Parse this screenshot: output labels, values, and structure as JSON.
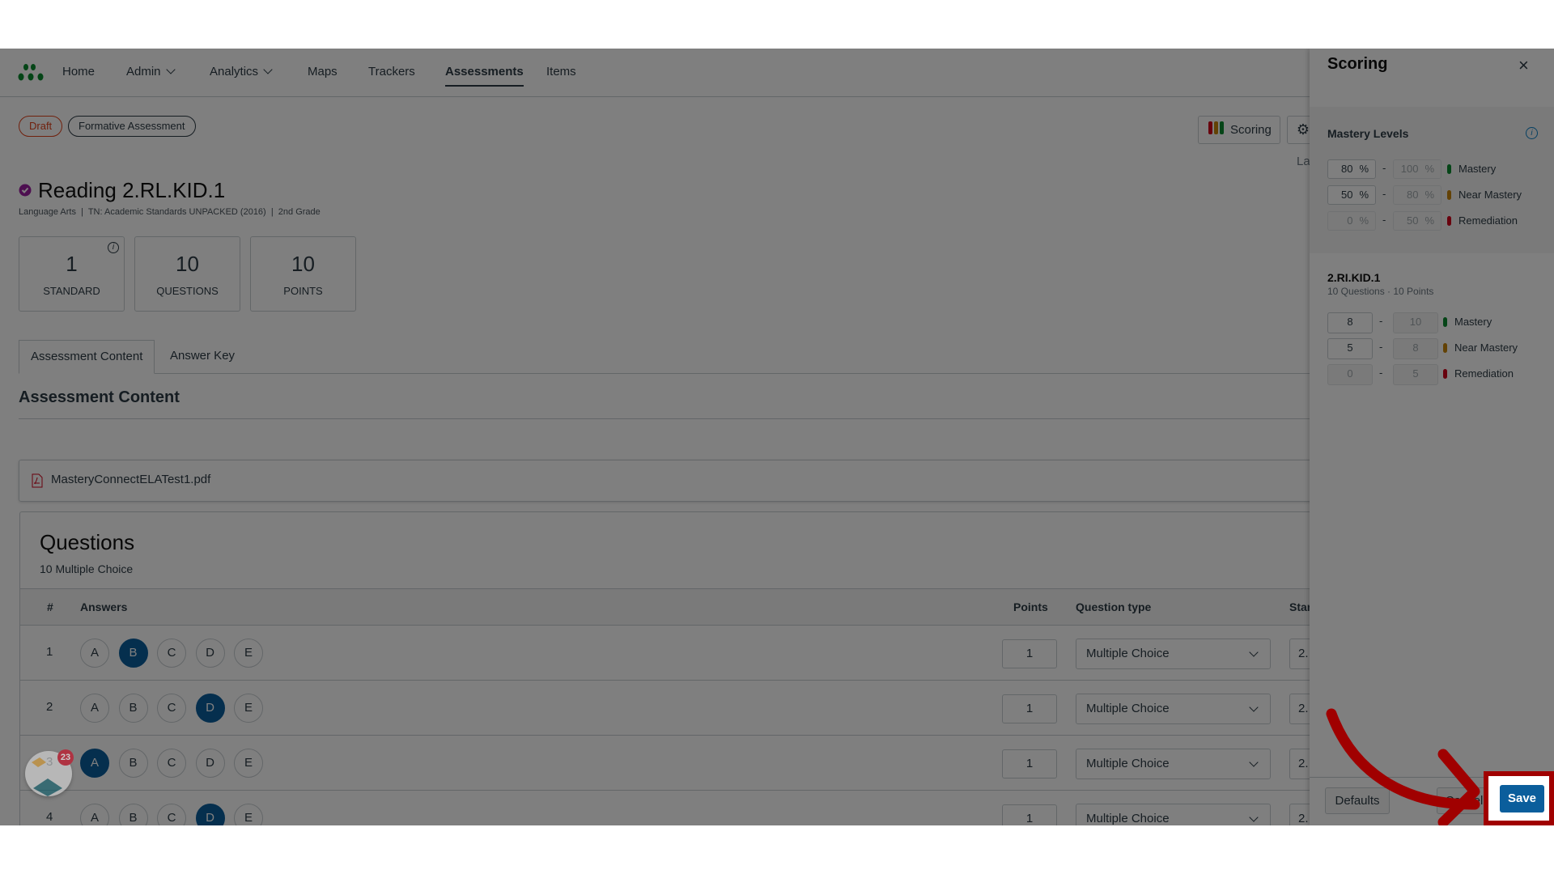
{
  "nav": {
    "items": [
      {
        "label": "Home"
      },
      {
        "label": "Admin",
        "dropdown": true
      },
      {
        "label": "Analytics",
        "dropdown": true
      },
      {
        "label": "Maps"
      },
      {
        "label": "Trackers"
      },
      {
        "label": "Assessments",
        "active": true
      },
      {
        "label": "Items"
      }
    ]
  },
  "badges": {
    "status": "Draft",
    "type": "Formative Assessment"
  },
  "assessment": {
    "title": "Reading 2.RL.KID.1",
    "meta": "Language Arts  |  TN: Academic Standards UNPACKED (2016)  |  2nd Grade"
  },
  "stats": [
    {
      "value": "1",
      "label": "STANDARD"
    },
    {
      "value": "10",
      "label": "QUESTIONS"
    },
    {
      "value": "10",
      "label": "POINTS"
    }
  ],
  "toolbar": {
    "scoring_label": "Scoring",
    "partial_text": "La"
  },
  "tabs": [
    {
      "label": "Assessment Content",
      "active": true
    },
    {
      "label": "Answer Key"
    }
  ],
  "content": {
    "heading": "Assessment Content",
    "file": "MasteryConnectELATest1.pdf"
  },
  "questions": {
    "title": "Questions",
    "subtitle": "10 Multiple Choice",
    "columns": {
      "num": "#",
      "answers": "Answers",
      "points": "Points",
      "type": "Question type",
      "standard": "Star"
    },
    "options": [
      "A",
      "B",
      "C",
      "D",
      "E"
    ],
    "rows": [
      {
        "num": "1",
        "selected": "B",
        "points": "1",
        "type": "Multiple Choice",
        "standard": "2."
      },
      {
        "num": "2",
        "selected": "D",
        "points": "1",
        "type": "Multiple Choice",
        "standard": "2."
      },
      {
        "num": "3",
        "selected": "A",
        "points": "1",
        "type": "Multiple Choice",
        "standard": "2."
      },
      {
        "num": "4",
        "selected": "D",
        "points": "1",
        "type": "Multiple Choice",
        "standard": "2."
      }
    ]
  },
  "widget": {
    "badge_count": "23"
  },
  "scoring_panel": {
    "title": "Scoring",
    "close": "×",
    "mastery": {
      "heading": "Mastery Levels",
      "levels": [
        {
          "min": "80",
          "max": "100",
          "unit": "%",
          "label": "Mastery",
          "color": "#0a8a2e"
        },
        {
          "min": "50",
          "max": "80",
          "unit": "%",
          "label": "Near Mastery",
          "color": "#c7850a"
        },
        {
          "min": "0",
          "max": "50",
          "unit": "%",
          "label": "Remediation",
          "color": "#d0021b"
        }
      ]
    },
    "standard": {
      "code": "2.RI.KID.1",
      "summary": "10 Questions · 10 Points",
      "levels": [
        {
          "min": "8",
          "max": "10",
          "label": "Mastery",
          "color": "#0a8a2e"
        },
        {
          "min": "5",
          "max": "8",
          "label": "Near Mastery",
          "color": "#c7850a"
        },
        {
          "min": "0",
          "max": "5",
          "label": "Remediation",
          "color": "#d0021b"
        }
      ]
    },
    "buttons": {
      "defaults": "Defaults",
      "cancel": "Cancel",
      "save": "Save"
    }
  },
  "colors": {
    "primary": "#0b5e9c",
    "highlight": "#a00000",
    "draft": "#e0421b"
  }
}
